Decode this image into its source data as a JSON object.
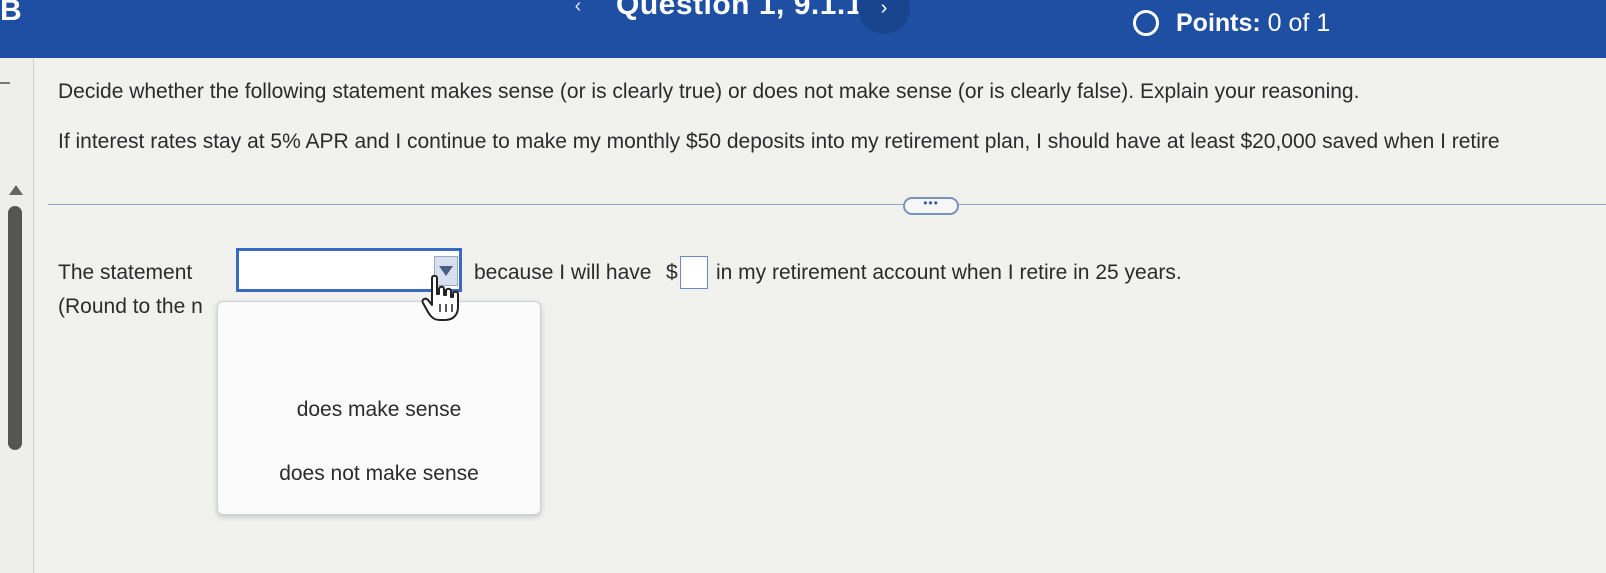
{
  "header": {
    "brand_letter": "B",
    "prev_arrow": "‹",
    "question_title": "Question 1, 9.1.1",
    "next_arrow": "›",
    "points_label": "Points:",
    "points_value": "0 of 1"
  },
  "question": {
    "instruction": "Decide whether the following statement makes sense (or is clearly true) or does not make sense (or is clearly false). Explain your reasoning.",
    "statement": "If interest rates stay at 5% APR and I continue to make my monthly $50 deposits into my retirement plan, I should have at least $20,000 saved when I retire"
  },
  "more_button_label": "•••",
  "answer": {
    "prefix": "The statement",
    "dropdown_value": "",
    "because": "because I will have",
    "dollar": "$",
    "amount_value": "",
    "suffix": "in my retirement account when I retire in 25 years.",
    "round_note": "(Round to the n"
  },
  "dropdown_options": [
    "does make sense",
    "does not make sense"
  ],
  "colors": {
    "header_bg": "#1f4fa3",
    "dropdown_border": "#3a68c4"
  },
  "icons": {
    "points": "circle-outline-icon",
    "cursor": "hand-pointer-icon",
    "dropdown": "triangle-down-icon"
  }
}
